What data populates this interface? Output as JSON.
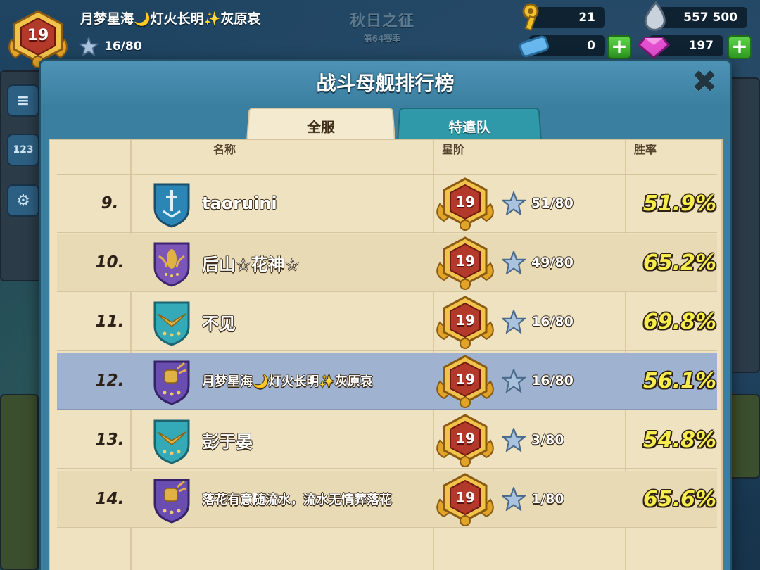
{
  "hud": {
    "player_level": "19",
    "player_name": "月梦星海🌙灯火长明✨灰原哀",
    "player_stars": "16/80",
    "season_title": "秋日之征",
    "season_sub": "第64赛季",
    "keys": "21",
    "iron": "557 500",
    "tickets": "0",
    "gems": "197",
    "plus_label": "+"
  },
  "panel": {
    "title": "战斗母舰排行榜",
    "close_label": "✖",
    "tabs": [
      {
        "label": "全服",
        "active": true
      },
      {
        "label": "特遣队",
        "active": false
      }
    ],
    "columns": {
      "name": "名称",
      "rank": "星阶",
      "winrate": "胜率"
    }
  },
  "leaderboard": {
    "rows": [
      {
        "rank": "9.",
        "name": "taoruini",
        "emblem": "blue-sword-shield-icon",
        "level": "19",
        "stars": "51/80",
        "winrate": "51.9%"
      },
      {
        "rank": "10.",
        "name": "后山☆花神☆",
        "emblem": "purple-rocket-shield-icon",
        "level": "19",
        "stars": "49/80",
        "winrate": "65.2%"
      },
      {
        "rank": "11.",
        "name": "不见",
        "emblem": "teal-wings-shield-icon",
        "level": "19",
        "stars": "16/80",
        "winrate": "69.8%"
      },
      {
        "rank": "12.",
        "name": "月梦星海🌙灯火长明✨灰原哀",
        "emblem": "purple-fist-shield-icon",
        "level": "19",
        "stars": "16/80",
        "winrate": "56.1%",
        "is_me": true
      },
      {
        "rank": "13.",
        "name": "彭于晏",
        "emblem": "teal-wings-shield-icon",
        "level": "19",
        "stars": "3/80",
        "winrate": "54.8%"
      },
      {
        "rank": "14.",
        "name": "落花有意随流水，流水无情葬落花",
        "emblem": "purple-fist-shield-icon",
        "level": "19",
        "stars": "1/80",
        "winrate": "65.6%"
      }
    ]
  },
  "colors": {
    "panel_blue": "#3b7fa0",
    "parchment": "#efe2c1",
    "highlight_row": "#9fb2cf",
    "winrate_yellow": "#f6ec4e",
    "badge_red": "#b33a2a",
    "badge_gold": "#e2a427"
  }
}
